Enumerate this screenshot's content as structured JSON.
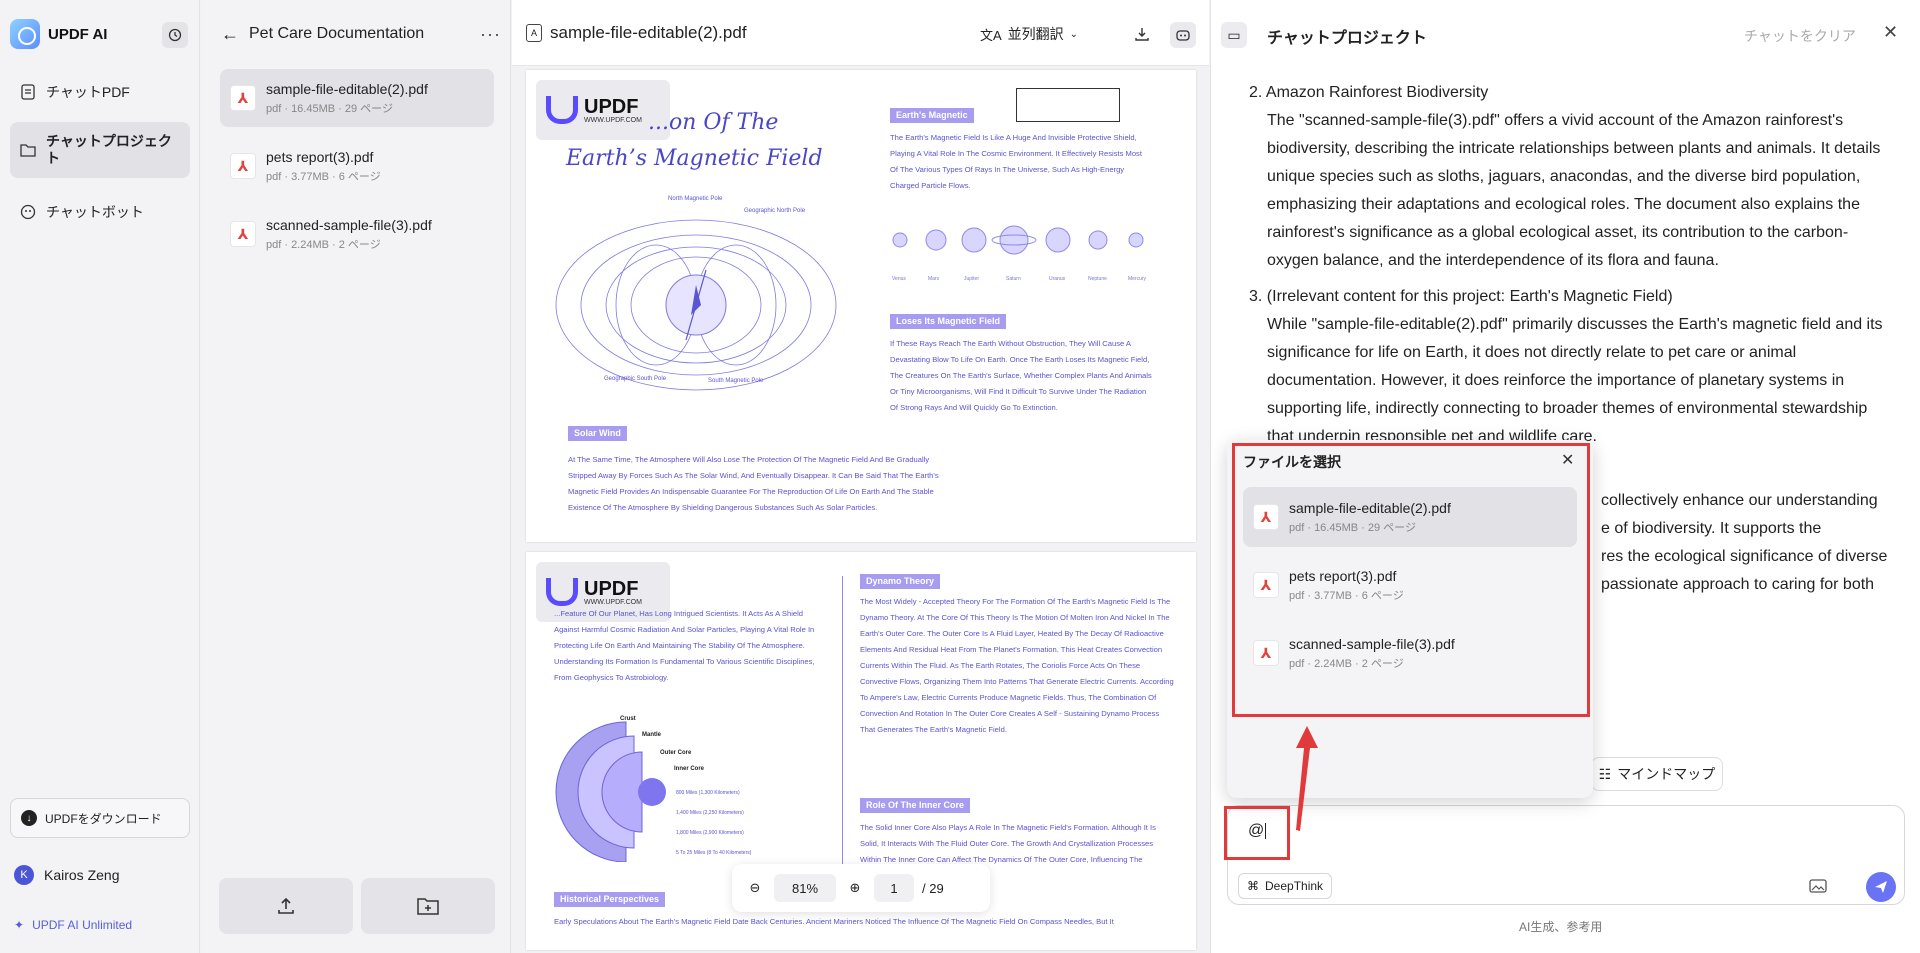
{
  "app": {
    "name": "UPDF AI",
    "nav": [
      {
        "label": "チャットPDF",
        "icon": "pdf-icon"
      },
      {
        "label": "チャットプロジェクト",
        "icon": "folder-icon",
        "active": true
      },
      {
        "label": "チャットボット",
        "icon": "bot-icon"
      }
    ],
    "download_label": "UPDFをダウンロード",
    "user_initial": "K",
    "user_name": "Kairos Zeng",
    "plan_label": "UPDF AI Unlimited"
  },
  "project": {
    "title": "Pet Care Documentation",
    "files": [
      {
        "name": "sample-file-editable(2).pdf",
        "meta": "pdf · 16.45MB · 29 ページ",
        "active": true
      },
      {
        "name": "pets report(3).pdf",
        "meta": "pdf · 3.77MB · 6 ページ"
      },
      {
        "name": "scanned-sample-file(3).pdf",
        "meta": "pdf · 2.24MB · 2 ページ"
      }
    ]
  },
  "viewer": {
    "filename": "sample-file-editable(2).pdf",
    "translate_label": "並列翻訳",
    "zoom": "81%",
    "page": "1",
    "total_pages": "/ 29",
    "page1": {
      "logo": "UPDF",
      "logo_url": "WWW.UPDF.COM",
      "title_line1": "...on Of The",
      "title_line2": "Earth’s Magnetic Field",
      "tag1": "Earth's Magnetic",
      "tag1_text": "The Earth's Magnetic Field Is Like A Huge And Invisible Protective Shield, Playing A Vital Role In The Cosmic Environment. It Effectively Resists Most Of The Various Types Of Rays In The Universe, Such As High-Energy Charged Particle Flows.",
      "tag2": "Loses Its Magnetic Field",
      "tag2_text": "If These Rays Reach The Earth Without Obstruction, They Will Cause A Devastating Blow To Life On Earth. Once The Earth Loses Its Magnetic Field, The Creatures On The Earth's Surface, Whether Complex Plants And Animals Or Tiny Microorganisms, Will Find It Difficult To Survive Under The Radiation Of Strong Rays And Will Quickly Go To Extinction.",
      "tag3": "Solar Wind",
      "tag3_text": "At The Same Time, The Atmosphere Will Also Lose The Protection Of The Magnetic Field And Be Gradually Stripped Away By Forces Such As The Solar Wind, And Eventually Disappear. It Can Be Said That The Earth's Magnetic Field Provides An Indispensable Guarantee For The Reproduction Of Life On Earth And The Stable Existence Of The Atmosphere By Shielding Dangerous Substances Such As Solar Particles.",
      "planets": [
        "Venus",
        "Mars",
        "Jupiter",
        "Saturn",
        "Uranus",
        "Neptune",
        "Mercury"
      ],
      "pole_labels": [
        "North Magnetic Pole",
        "Geographic North Pole",
        "Geographic South Pole",
        "South Magnetic Pole"
      ]
    },
    "page2": {
      "logo": "UPDF",
      "logo_url": "WWW.UPDF.COM",
      "intro_text": "...Feature Of Our Planet, Has Long Intrigued Scientists. It Acts As A Shield Against Harmful Cosmic Radiation And Solar Particles, Playing A Vital Role In Protecting Life On Earth And Maintaining The Stability Of The Atmosphere. Understanding Its Formation Is Fundamental To Various Scientific Disciplines, From Geophysics To Astrobiology.",
      "tag1": "Dynamo Theory",
      "tag1_text": "The Most Widely - Accepted Theory For The Formation Of The Earth's Magnetic Field Is The Dynamo Theory. At The Core Of This Theory Is The Motion Of Molten Iron And Nickel In The Earth's Outer Core. The Outer Core Is A Fluid Layer, Heated By The Decay Of Radioactive Elements And Residual Heat From The Planet's Formation. This Heat Creates Convection Currents Within The Fluid. As The Earth Rotates, The Coriolis Force Acts On These Convective Flows, Organizing Them Into Patterns That Generate Electric Currents. According To Ampere's Law, Electric Currents Produce Magnetic Fields. Thus, The Combination Of Convection And Rotation In The Outer Core Creates A Self - Sustaining Dynamo Process That Generates The Earth's Magnetic Field.",
      "tag2": "Role Of The Inner Core",
      "tag2_text": "The Solid Inner Core Also Plays A Role In The Magnetic Field's Formation. Although It Is Solid, It Interacts With The Fluid Outer Core. The Growth And Crystallization Processes Within The Inner Core Can Affect The Dynamics Of The Outer Core, Influencing The ...Magnetic Field Generation.",
      "tag3": "Historical Perspectives",
      "tag3_text": "Early Speculations About The Earth's Magnetic Field Date Back Centuries. Ancient Mariners Noticed The Influence Of The Magnetic Field On Compass Needles, But It",
      "layers": [
        "Crust",
        "Mantle",
        "Outer Core",
        "Inner Core"
      ],
      "depths": [
        "800 Miles (1,300 Kilometers)",
        "1,400 Miles (2,250 Kilometers)",
        "1,800 Miles (2,900 Kilometers)",
        "5 To 25 Miles (8 To 40 Kilometers)"
      ]
    }
  },
  "chat": {
    "title": "チャットプロジェクト",
    "clear_label": "チャットをクリア",
    "item2_head": "2. Amazon Rainforest Biodiversity",
    "item2_lines": [
      "The \"scanned-sample-file(3).pdf\" offers a vivid account of the Amazon rainforest's",
      "biodiversity, describing the intricate relationships between plants and animals. It details",
      "unique species such as sloths, jaguars, anacondas, and the diverse bird population,",
      "emphasizing their adaptations and ecological roles. The document also explains the",
      "rainforest's significance as a global ecological asset, its contribution to the carbon-",
      "oxygen balance, and the interdependence of its flora and fauna."
    ],
    "item3_head": "3. (Irrelevant content for this project: Earth's Magnetic Field)",
    "item3_lines": [
      "While \"sample-file-editable(2).pdf\" primarily discusses the Earth's magnetic field and its",
      "significance for life on Earth, it does not directly relate to pet care or animal",
      "documentation. However, it does reinforce the importance of planetary systems in",
      "supporting life, indirectly connecting to broader themes of environmental stewardship",
      "that underpin responsible pet and wildlife care."
    ],
    "partial_lines": [
      "collectively enhance our understanding",
      "e of biodiversity. It supports the",
      "res the ecological significance of diverse",
      "passionate approach to caring for both"
    ],
    "mindmap_label": "マインドマップ",
    "input_value": "@",
    "deepthink_label": "DeepThink",
    "footer_note": "AI生成、参考用"
  },
  "popup": {
    "title": "ファイルを選択",
    "files": [
      {
        "name": "sample-file-editable(2).pdf",
        "meta": "pdf · 16.45MB · 29 ページ",
        "active": true
      },
      {
        "name": "pets report(3).pdf",
        "meta": "pdf · 3.77MB · 6 ページ"
      },
      {
        "name": "scanned-sample-file(3).pdf",
        "meta": "pdf · 2.24MB · 2 ページ"
      }
    ]
  },
  "colors": {
    "accent": "#6b73f5",
    "annotation_red": "#e03a3a",
    "pdf_text": "#5a55d0"
  }
}
